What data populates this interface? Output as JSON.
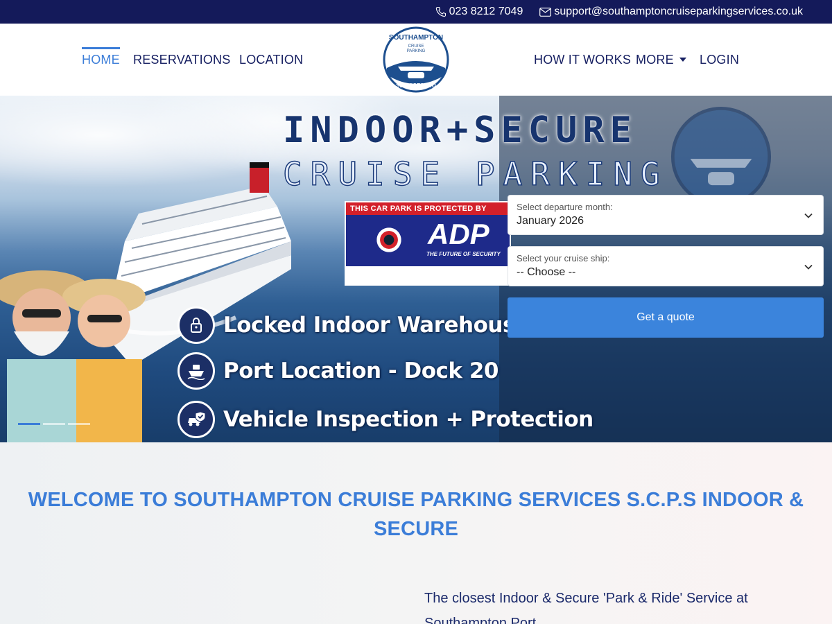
{
  "topbar": {
    "phone": "023 8212 7049",
    "email": "support@southamptoncruiseparkingservices.co.uk"
  },
  "nav": {
    "left": [
      "HOME",
      "RESERVATIONS",
      "LOCATION"
    ],
    "right": [
      "HOW IT WORKS",
      "MORE",
      "LOGIN"
    ],
    "active": "HOME"
  },
  "logo": {
    "line1": "SOUTHAMPTON",
    "line2": "CRUISE",
    "line3": "PARKING",
    "line4": "SERVICES LTD"
  },
  "hero": {
    "title_line1": "INDOOR+SECURE",
    "title_line2": "CRUISE PARKING",
    "adp_banner": "THIS CAR PARK IS PROTECTED BY",
    "adp_logo": "ADP",
    "adp_tagline": "THE FUTURE OF SECURITY",
    "features": [
      {
        "icon": "lock-icon",
        "text": "Locked Indoor Warehouse"
      },
      {
        "icon": "ship-icon",
        "text": "Port  Location - Dock 20"
      },
      {
        "icon": "car-shield-icon",
        "text": "Vehicle Inspection + Protection"
      }
    ],
    "slides_total": 3,
    "slide_active": 1
  },
  "form": {
    "departure_label": "Select departure month:",
    "departure_value": "January 2026",
    "ship_label": "Select your cruise ship:",
    "ship_value": "-- Choose --",
    "button": "Get a quote"
  },
  "welcome": {
    "heading": "WELCOME TO SOUTHAMPTON CRUISE PARKING SERVICES S.C.P.S INDOOR & SECURE",
    "intro": "The closest Indoor & Secure 'Park & Ride' Service at Southampton Port"
  },
  "colors": {
    "topbar": "#141a5a",
    "accent": "#3b7dd8",
    "nav_text": "#172062"
  }
}
